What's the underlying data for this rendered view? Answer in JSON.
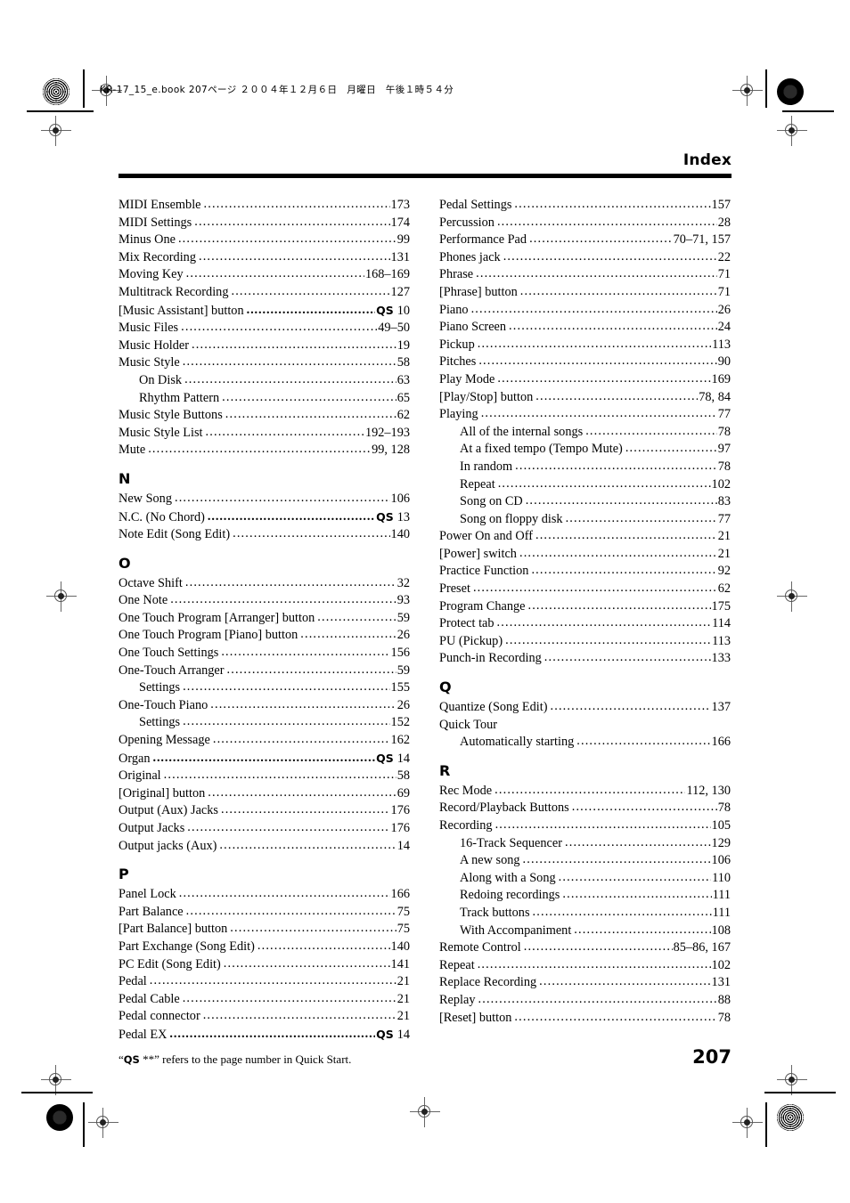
{
  "document": {
    "file_info_line": "KR-17_15_e.book  207ページ  ２００４年１２月６日　月曜日　午後１時５４分",
    "header_title": "Index",
    "footer_note_prefix": "“",
    "footer_note_qs": "QS",
    "footer_note_suffix": " **” refers to the page number in Quick Start.",
    "page_number": "207"
  },
  "index": {
    "left_column": [
      {
        "type": "entry",
        "label": "MIDI Ensemble",
        "page": "173"
      },
      {
        "type": "entry",
        "label": "MIDI Settings",
        "page": "174"
      },
      {
        "type": "entry",
        "label": "Minus One",
        "page": "99"
      },
      {
        "type": "entry",
        "label": "Mix Recording",
        "page": "131"
      },
      {
        "type": "entry",
        "label": "Moving Key",
        "page": "168–169"
      },
      {
        "type": "entry",
        "label": "Multitrack Recording",
        "page": "127"
      },
      {
        "type": "qs",
        "label": "[Music Assistant] button",
        "qs": "QS",
        "page": "10"
      },
      {
        "type": "entry",
        "label": "Music Files",
        "page": "49–50"
      },
      {
        "type": "entry",
        "label": "Music Holder",
        "page": "19"
      },
      {
        "type": "entry",
        "label": "Music Style",
        "page": "58"
      },
      {
        "type": "sub",
        "label": "On Disk",
        "page": "63"
      },
      {
        "type": "sub",
        "label": "Rhythm Pattern",
        "page": "65"
      },
      {
        "type": "entry",
        "label": "Music Style Buttons",
        "page": "62"
      },
      {
        "type": "entry",
        "label": "Music Style List",
        "page": "192–193"
      },
      {
        "type": "entry",
        "label": "Mute",
        "page": "99, 128"
      },
      {
        "type": "letter",
        "label": "N"
      },
      {
        "type": "entry",
        "label": "New Song",
        "page": "106"
      },
      {
        "type": "qs",
        "label": "N.C. (No Chord)",
        "qs": "QS",
        "page": "13"
      },
      {
        "type": "entry",
        "label": "Note Edit (Song Edit)",
        "page": "140"
      },
      {
        "type": "letter",
        "label": "O"
      },
      {
        "type": "entry",
        "label": "Octave Shift",
        "page": "32"
      },
      {
        "type": "entry",
        "label": "One Note",
        "page": "93"
      },
      {
        "type": "entry",
        "label": "One Touch Program [Arranger] button",
        "page": "59"
      },
      {
        "type": "entry",
        "label": "One Touch Program [Piano] button",
        "page": "26"
      },
      {
        "type": "entry",
        "label": "One Touch Settings",
        "page": "156"
      },
      {
        "type": "entry",
        "label": "One-Touch Arranger",
        "page": "59"
      },
      {
        "type": "sub",
        "label": "Settings",
        "page": "155"
      },
      {
        "type": "entry",
        "label": "One-Touch Piano",
        "page": "26"
      },
      {
        "type": "sub",
        "label": "Settings",
        "page": "152"
      },
      {
        "type": "entry",
        "label": "Opening Message",
        "page": "162"
      },
      {
        "type": "qs",
        "label": "Organ",
        "qs": "QS",
        "page": "14"
      },
      {
        "type": "entry",
        "label": "Original",
        "page": "58"
      },
      {
        "type": "entry",
        "label": "[Original] button",
        "page": "69"
      },
      {
        "type": "entry",
        "label": "Output (Aux) Jacks",
        "page": "176"
      },
      {
        "type": "entry",
        "label": "Output Jacks",
        "page": "176"
      },
      {
        "type": "entry",
        "label": "Output jacks (Aux)",
        "page": "14"
      },
      {
        "type": "letter",
        "label": "P"
      },
      {
        "type": "entry",
        "label": "Panel Lock",
        "page": "166"
      },
      {
        "type": "entry",
        "label": "Part Balance",
        "page": "75"
      },
      {
        "type": "entry",
        "label": "[Part Balance] button",
        "page": "75"
      },
      {
        "type": "entry",
        "label": "Part Exchange (Song Edit)",
        "page": "140"
      },
      {
        "type": "entry",
        "label": "PC Edit (Song Edit)",
        "page": "141"
      },
      {
        "type": "entry",
        "label": "Pedal",
        "page": "21"
      },
      {
        "type": "entry",
        "label": "Pedal Cable",
        "page": "21"
      },
      {
        "type": "entry",
        "label": "Pedal connector",
        "page": "21"
      },
      {
        "type": "qs",
        "label": "Pedal EX",
        "qs": "QS",
        "page": "14"
      }
    ],
    "right_column": [
      {
        "type": "entry",
        "label": "Pedal Settings",
        "page": "157"
      },
      {
        "type": "entry",
        "label": "Percussion",
        "page": "28"
      },
      {
        "type": "entry",
        "label": "Performance Pad",
        "page": "70–71, 157"
      },
      {
        "type": "entry",
        "label": "Phones jack",
        "page": "22"
      },
      {
        "type": "entry",
        "label": "Phrase",
        "page": "71"
      },
      {
        "type": "entry",
        "label": "[Phrase] button",
        "page": "71"
      },
      {
        "type": "entry",
        "label": "Piano",
        "page": "26"
      },
      {
        "type": "entry",
        "label": "Piano Screen",
        "page": "24"
      },
      {
        "type": "entry",
        "label": "Pickup",
        "page": "113"
      },
      {
        "type": "entry",
        "label": "Pitches",
        "page": "90"
      },
      {
        "type": "entry",
        "label": "Play Mode",
        "page": "169"
      },
      {
        "type": "entry",
        "label": "[Play/Stop] button",
        "page": "78, 84"
      },
      {
        "type": "entry",
        "label": "Playing",
        "page": "77"
      },
      {
        "type": "sub",
        "label": "All of the internal songs",
        "page": "78"
      },
      {
        "type": "sub",
        "label": "At a fixed tempo (Tempo Mute)",
        "page": "97"
      },
      {
        "type": "sub",
        "label": "In random",
        "page": "78"
      },
      {
        "type": "sub",
        "label": "Repeat",
        "page": "102"
      },
      {
        "type": "sub",
        "label": "Song on CD",
        "page": "83"
      },
      {
        "type": "sub",
        "label": "Song on floppy disk",
        "page": "77"
      },
      {
        "type": "entry",
        "label": "Power On and Off",
        "page": "21"
      },
      {
        "type": "entry",
        "label": "[Power] switch",
        "page": "21"
      },
      {
        "type": "entry",
        "label": "Practice Function",
        "page": "92"
      },
      {
        "type": "entry",
        "label": "Preset",
        "page": "62"
      },
      {
        "type": "entry",
        "label": "Program Change",
        "page": "175"
      },
      {
        "type": "entry",
        "label": "Protect tab",
        "page": "114"
      },
      {
        "type": "entry",
        "label": "PU (Pickup)",
        "page": "113"
      },
      {
        "type": "entry",
        "label": "Punch-in Recording",
        "page": "133"
      },
      {
        "type": "letter",
        "label": "Q"
      },
      {
        "type": "entry",
        "label": "Quantize (Song Edit)",
        "page": "137"
      },
      {
        "type": "noleader",
        "label": "Quick Tour"
      },
      {
        "type": "sub",
        "label": "Automatically starting",
        "page": "166"
      },
      {
        "type": "letter",
        "label": "R"
      },
      {
        "type": "entry",
        "label": "Rec Mode",
        "page": "112, 130"
      },
      {
        "type": "entry",
        "label": "Record/Playback Buttons",
        "page": "78"
      },
      {
        "type": "entry",
        "label": "Recording",
        "page": "105"
      },
      {
        "type": "sub",
        "label": "16-Track Sequencer",
        "page": "129"
      },
      {
        "type": "sub",
        "label": "A new song",
        "page": "106"
      },
      {
        "type": "sub",
        "label": "Along with a Song",
        "page": "110"
      },
      {
        "type": "sub",
        "label": "Redoing recordings",
        "page": "111"
      },
      {
        "type": "sub",
        "label": "Track buttons",
        "page": "111"
      },
      {
        "type": "sub",
        "label": "With Accompaniment",
        "page": "108"
      },
      {
        "type": "entry",
        "label": "Remote Control",
        "page": "85–86, 167"
      },
      {
        "type": "entry",
        "label": "Repeat",
        "page": "102"
      },
      {
        "type": "entry",
        "label": "Replace Recording",
        "page": "131"
      },
      {
        "type": "entry",
        "label": "Replay",
        "page": "88"
      },
      {
        "type": "entry",
        "label": "[Reset] button",
        "page": "78"
      }
    ]
  }
}
